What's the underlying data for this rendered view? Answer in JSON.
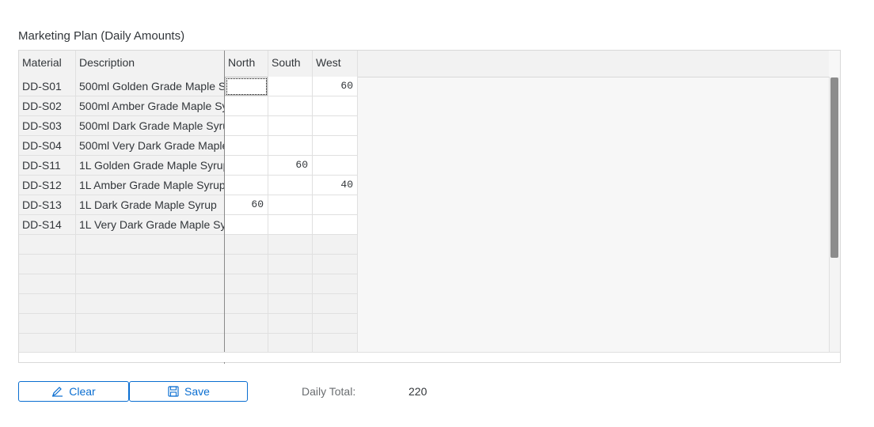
{
  "title": "Marketing Plan (Daily Amounts)",
  "columns": {
    "material": "Material",
    "description": "Description",
    "north": "North",
    "south": "South",
    "west": "West"
  },
  "rows": [
    {
      "material": "DD-S01",
      "description": "500ml Golden Grade Maple S",
      "north": "",
      "south": "",
      "west": "60"
    },
    {
      "material": "DD-S02",
      "description": "500ml Amber Grade Maple Sy",
      "north": "",
      "south": "",
      "west": ""
    },
    {
      "material": "DD-S03",
      "description": "500ml Dark Grade Maple Syru",
      "north": "",
      "south": "",
      "west": ""
    },
    {
      "material": "DD-S04",
      "description": "500ml Very Dark Grade Maple",
      "north": "",
      "south": "",
      "west": ""
    },
    {
      "material": "DD-S11",
      "description": "1L Golden Grade Maple Syrup",
      "north": "",
      "south": "60",
      "west": ""
    },
    {
      "material": "DD-S12",
      "description": "1L Amber Grade Maple Syrup",
      "north": "",
      "south": "",
      "west": "40"
    },
    {
      "material": "DD-S13",
      "description": "1L Dark Grade Maple Syrup",
      "north": "60",
      "south": "",
      "west": ""
    },
    {
      "material": "DD-S14",
      "description": "1L Very Dark Grade Maple Sy",
      "north": "",
      "south": "",
      "west": ""
    }
  ],
  "footer": {
    "clear_label": "Clear",
    "save_label": "Save",
    "total_label": "Daily Total:",
    "total_value": "220"
  },
  "colors": {
    "accent": "#0a6ed1",
    "grid_bg": "#f2f2f2",
    "scroll_thumb": "#8c8c8c"
  }
}
